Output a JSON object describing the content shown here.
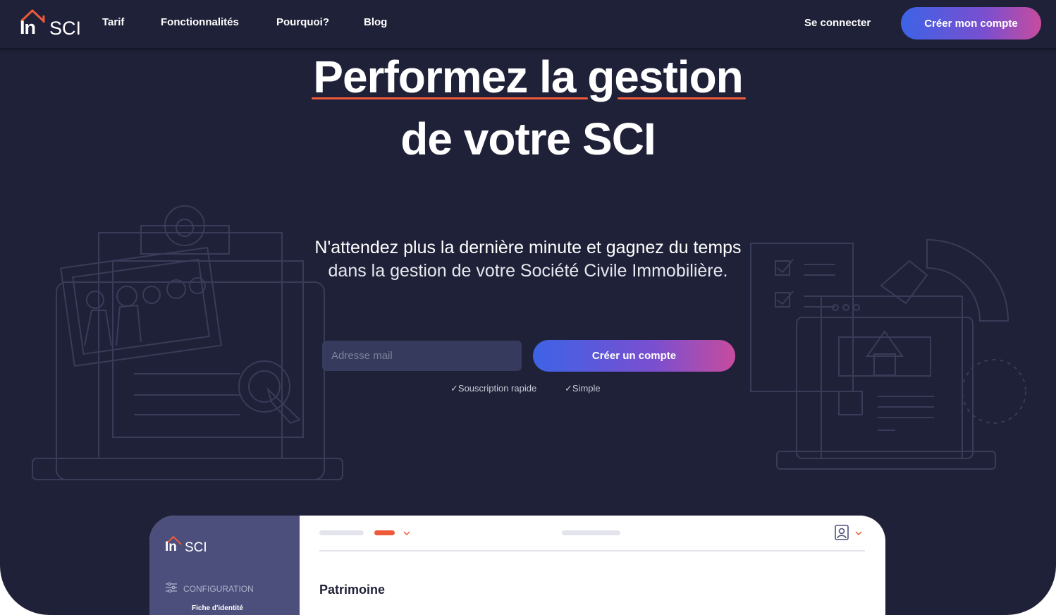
{
  "brand": {
    "logo_in": "In",
    "logo_sci": "SCI",
    "accent": "#ee5a3a",
    "background": "#1f2138"
  },
  "nav": {
    "links": [
      "Tarif",
      "Fonctionnalités",
      "Pourquoi?",
      "Blog"
    ],
    "login": "Se connecter",
    "cta": "Créer mon compte"
  },
  "hero": {
    "title_line1": "Performez la gestion",
    "title_line2": "de votre SCI",
    "subtitle_line1": "N'attendez plus la dernière minute et gagnez du temps",
    "subtitle_line2": "dans la gestion de votre Société Civile Immobilière."
  },
  "signup": {
    "email_placeholder": "Adresse mail",
    "cta": "Créer un compte",
    "features": [
      "✓Souscription rapide",
      "✓Simple"
    ]
  },
  "app_preview": {
    "logo_in": "In",
    "logo_sci": "SCI",
    "sidebar_section": "CONFIGURATION",
    "sidebar_item": "Fiche d'identité",
    "page_title": "Patrimoine"
  },
  "icons": [
    "house-roof-icon",
    "settings-sliders-icon",
    "user-profile-icon",
    "chevron-down-icon",
    "check-icon"
  ]
}
